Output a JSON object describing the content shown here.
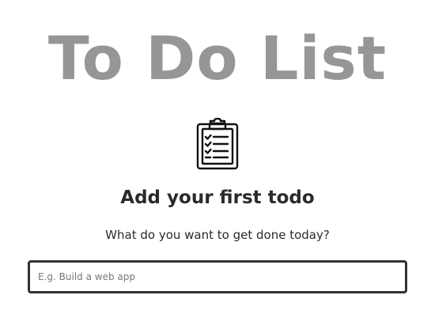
{
  "app": {
    "title": "To Do List"
  },
  "empty_state": {
    "icon": "clipboard-checklist-icon",
    "heading": "Add your first todo",
    "subtext": "What do you want to get done today?"
  },
  "todo_input": {
    "value": "",
    "placeholder": "E.g. Build a web app"
  },
  "colors": {
    "title": "#969696",
    "text": "#2b2b2b",
    "input_border": "#333333",
    "background": "#ffffff"
  }
}
